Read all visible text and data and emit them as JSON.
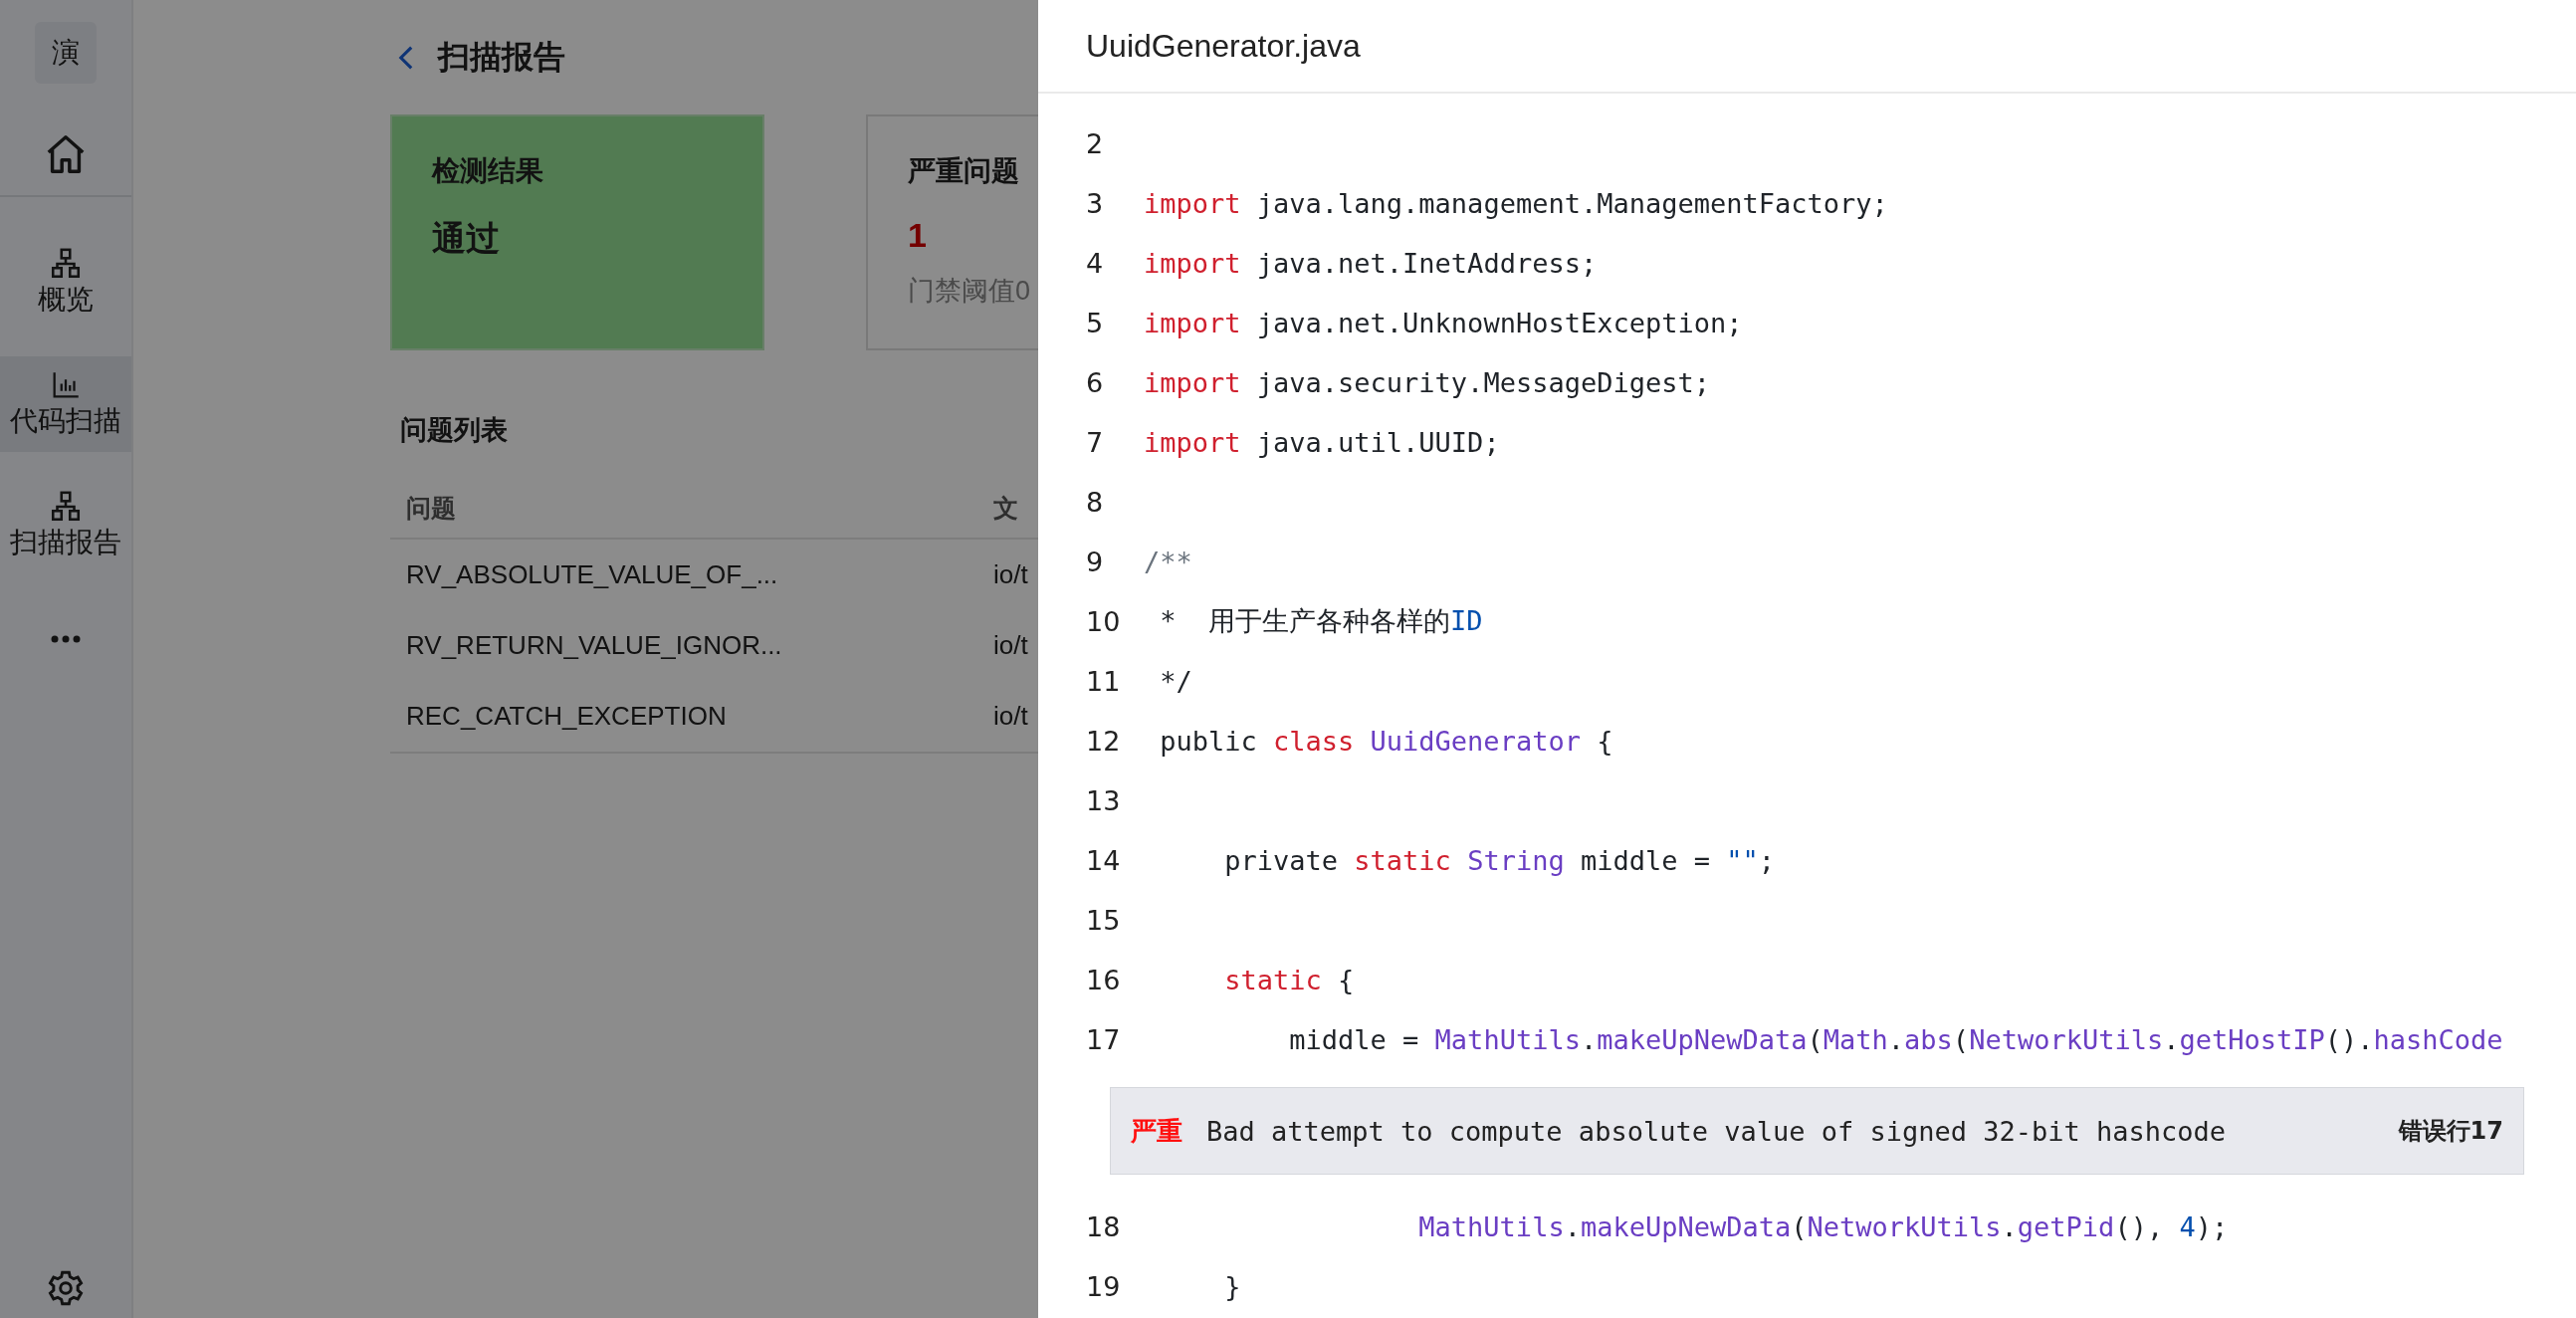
{
  "sidebar": {
    "logo": "演",
    "items": [
      {
        "label": "概览",
        "selected": false
      },
      {
        "label": "代码扫描",
        "selected": true
      },
      {
        "label": "扫描报告",
        "selected": false
      }
    ]
  },
  "page": {
    "title": "扫描报告",
    "cards": [
      {
        "kind": "result",
        "title": "检测结果",
        "value": "通过"
      },
      {
        "kind": "count",
        "title": "严重问题",
        "value": "1",
        "note": "门禁阈值0"
      }
    ],
    "issues": {
      "title": "问题列表",
      "columns": [
        "问题",
        "文"
      ],
      "rows": [
        [
          "RV_ABSOLUTE_VALUE_OF_...",
          "io/t"
        ],
        [
          "RV_RETURN_VALUE_IGNOR...",
          "io/t"
        ],
        [
          "REC_CATCH_EXCEPTION",
          "io/t"
        ]
      ]
    }
  },
  "drawer": {
    "title": "UuidGenerator.java",
    "lines": [
      {
        "kind": "code",
        "number": "2"
      },
      {
        "kind": "code",
        "number": "3",
        "tokens": [
          {
            "kind": "keyword",
            "text": "import"
          },
          {
            "kind": "plain",
            "text": " java.lang.management.ManagementFactory;"
          }
        ]
      },
      {
        "kind": "code",
        "number": "4",
        "tokens": [
          {
            "kind": "keyword",
            "text": "import"
          },
          {
            "kind": "plain",
            "text": " java.net.InetAddress;"
          }
        ]
      },
      {
        "kind": "code",
        "number": "5",
        "tokens": [
          {
            "kind": "keyword",
            "text": "import"
          },
          {
            "kind": "plain",
            "text": " java.net.UnknownHostException;"
          }
        ]
      },
      {
        "kind": "code",
        "number": "6",
        "tokens": [
          {
            "kind": "keyword",
            "text": "import"
          },
          {
            "kind": "plain",
            "text": " java.security.MessageDigest;"
          }
        ]
      },
      {
        "kind": "code",
        "number": "7",
        "tokens": [
          {
            "kind": "keyword",
            "text": "import"
          },
          {
            "kind": "plain",
            "text": " java.util.UUID;"
          }
        ]
      },
      {
        "kind": "code",
        "number": "8"
      },
      {
        "kind": "code",
        "number": "9",
        "tokens": [
          {
            "kind": "comment",
            "text": "/**"
          }
        ]
      },
      {
        "kind": "code",
        "number": "10",
        "tokens": [
          {
            "kind": "plain",
            "text": " *  用于生产各种各样的"
          },
          {
            "kind": "literal",
            "text": "ID"
          }
        ]
      },
      {
        "kind": "code",
        "number": "11",
        "tokens": [
          {
            "kind": "plain",
            "text": " */"
          }
        ]
      },
      {
        "kind": "code",
        "number": "12",
        "tokens": [
          {
            "kind": "plain",
            "text": " public "
          },
          {
            "kind": "keyword",
            "text": "class"
          },
          {
            "kind": "type",
            "text": " UuidGenerator"
          },
          {
            "kind": "plain",
            "text": " {"
          }
        ]
      },
      {
        "kind": "code",
        "number": "13"
      },
      {
        "kind": "code",
        "number": "14",
        "tokens": [
          {
            "kind": "plain",
            "text": "     private "
          },
          {
            "kind": "keyword",
            "text": "static"
          },
          {
            "kind": "type",
            "text": " String"
          },
          {
            "kind": "plain",
            "text": " middle = "
          },
          {
            "kind": "literal",
            "text": "\"\""
          },
          {
            "kind": "plain",
            "text": ";"
          }
        ]
      },
      {
        "kind": "code",
        "number": "15"
      },
      {
        "kind": "code",
        "number": "16",
        "tokens": [
          {
            "kind": "keyword",
            "text": "     static"
          },
          {
            "kind": "plain",
            "text": " {"
          }
        ]
      },
      {
        "kind": "code",
        "number": "17",
        "tokens": [
          {
            "kind": "plain",
            "text": "         middle = "
          },
          {
            "kind": "type",
            "text": "MathUtils"
          },
          {
            "kind": "plain",
            "text": "."
          },
          {
            "kind": "type",
            "text": "makeUpNewData"
          },
          {
            "kind": "plain",
            "text": "("
          },
          {
            "kind": "type",
            "text": "Math"
          },
          {
            "kind": "plain",
            "text": "."
          },
          {
            "kind": "type",
            "text": "abs"
          },
          {
            "kind": "plain",
            "text": "("
          },
          {
            "kind": "type",
            "text": "NetworkUtils"
          },
          {
            "kind": "plain",
            "text": "."
          },
          {
            "kind": "type",
            "text": "getHostIP"
          },
          {
            "kind": "plain",
            "text": "()."
          },
          {
            "kind": "type",
            "text": "hashCode"
          }
        ]
      },
      {
        "kind": "issue",
        "severity": "严重",
        "message": "Bad attempt to compute absolute value of signed 32-bit hashcode",
        "location": "错误行17"
      },
      {
        "kind": "code",
        "number": "18",
        "tokens": [
          {
            "kind": "type",
            "text": "                 MathUtils"
          },
          {
            "kind": "plain",
            "text": "."
          },
          {
            "kind": "type",
            "text": "makeUpNewData"
          },
          {
            "kind": "plain",
            "text": "("
          },
          {
            "kind": "type",
            "text": "NetworkUtils"
          },
          {
            "kind": "plain",
            "text": "."
          },
          {
            "kind": "type",
            "text": "getPid"
          },
          {
            "kind": "plain",
            "text": "(), "
          },
          {
            "kind": "literal",
            "text": "4"
          },
          {
            "kind": "plain",
            "text": ");"
          }
        ]
      },
      {
        "kind": "code",
        "number": "19",
        "tokens": [
          {
            "kind": "plain",
            "text": "     }"
          }
        ]
      }
    ]
  }
}
